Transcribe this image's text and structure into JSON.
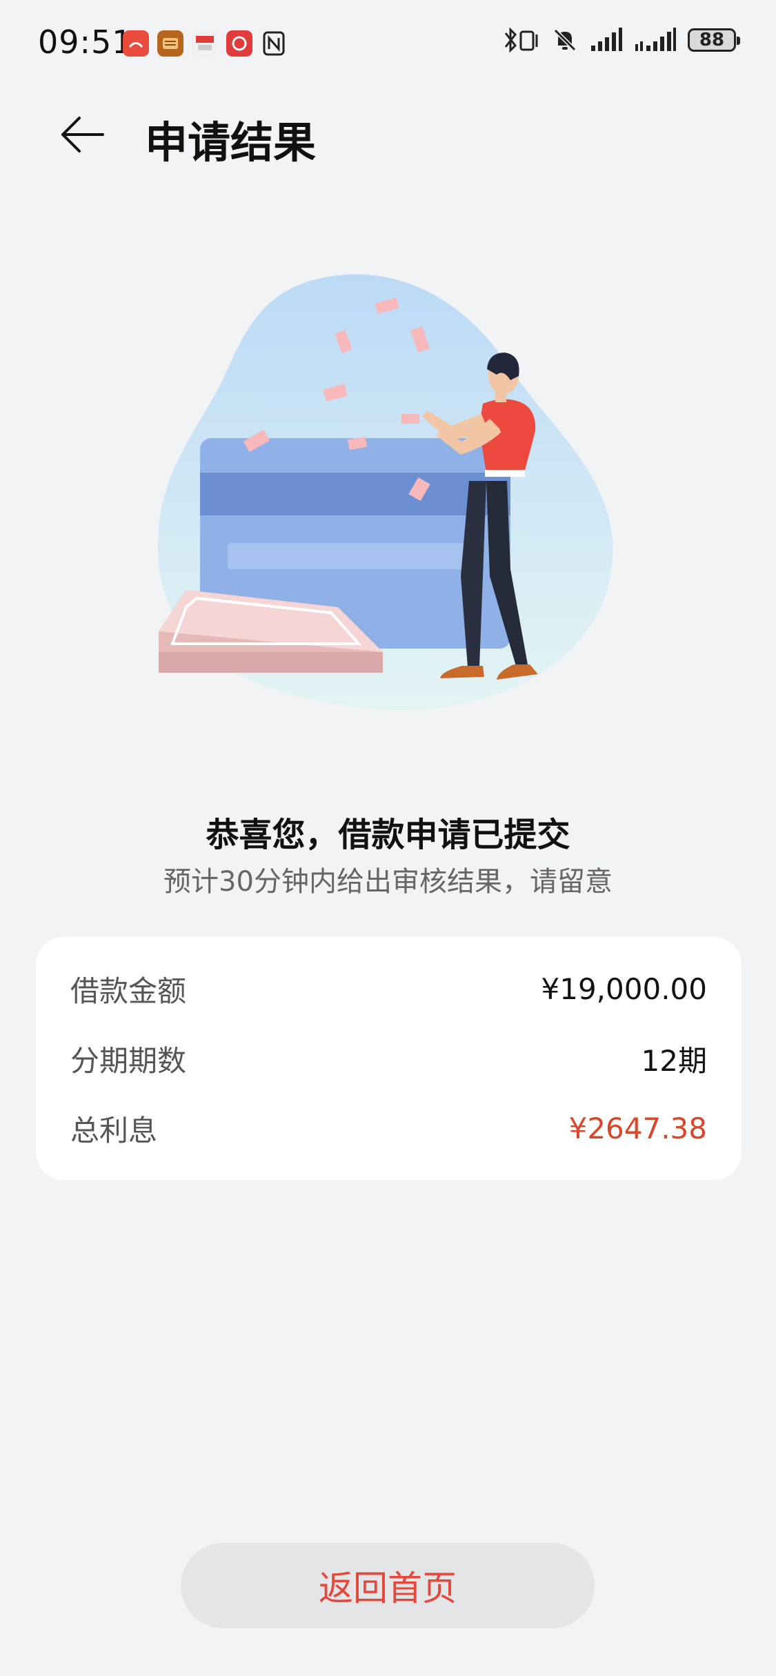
{
  "status_bar": {
    "time": "09:51",
    "battery_level": "88",
    "icons": [
      "app-notification-icon",
      "app-notification-icon",
      "app-notification-icon",
      "app-notification-icon",
      "nfc-icon",
      "bluetooth-icon",
      "vibrate-icon",
      "mute-icon",
      "signal-icon",
      "signal-icon"
    ]
  },
  "header": {
    "title": "申请结果"
  },
  "message": {
    "title": "恭喜您，借款申请已提交",
    "subtitle": "预计30分钟内给出审核结果，请留意"
  },
  "loan_info": {
    "rows": [
      {
        "label": "借款金额",
        "value": "¥19,000.00"
      },
      {
        "label": "分期期数",
        "value": "12期"
      },
      {
        "label": "总利息",
        "value": "¥2647.38"
      }
    ]
  },
  "actions": {
    "home_button": "返回首页"
  },
  "colors": {
    "accent_red": "#e5473b",
    "interest_red": "#d9472b",
    "background": "#f1f3f5"
  }
}
